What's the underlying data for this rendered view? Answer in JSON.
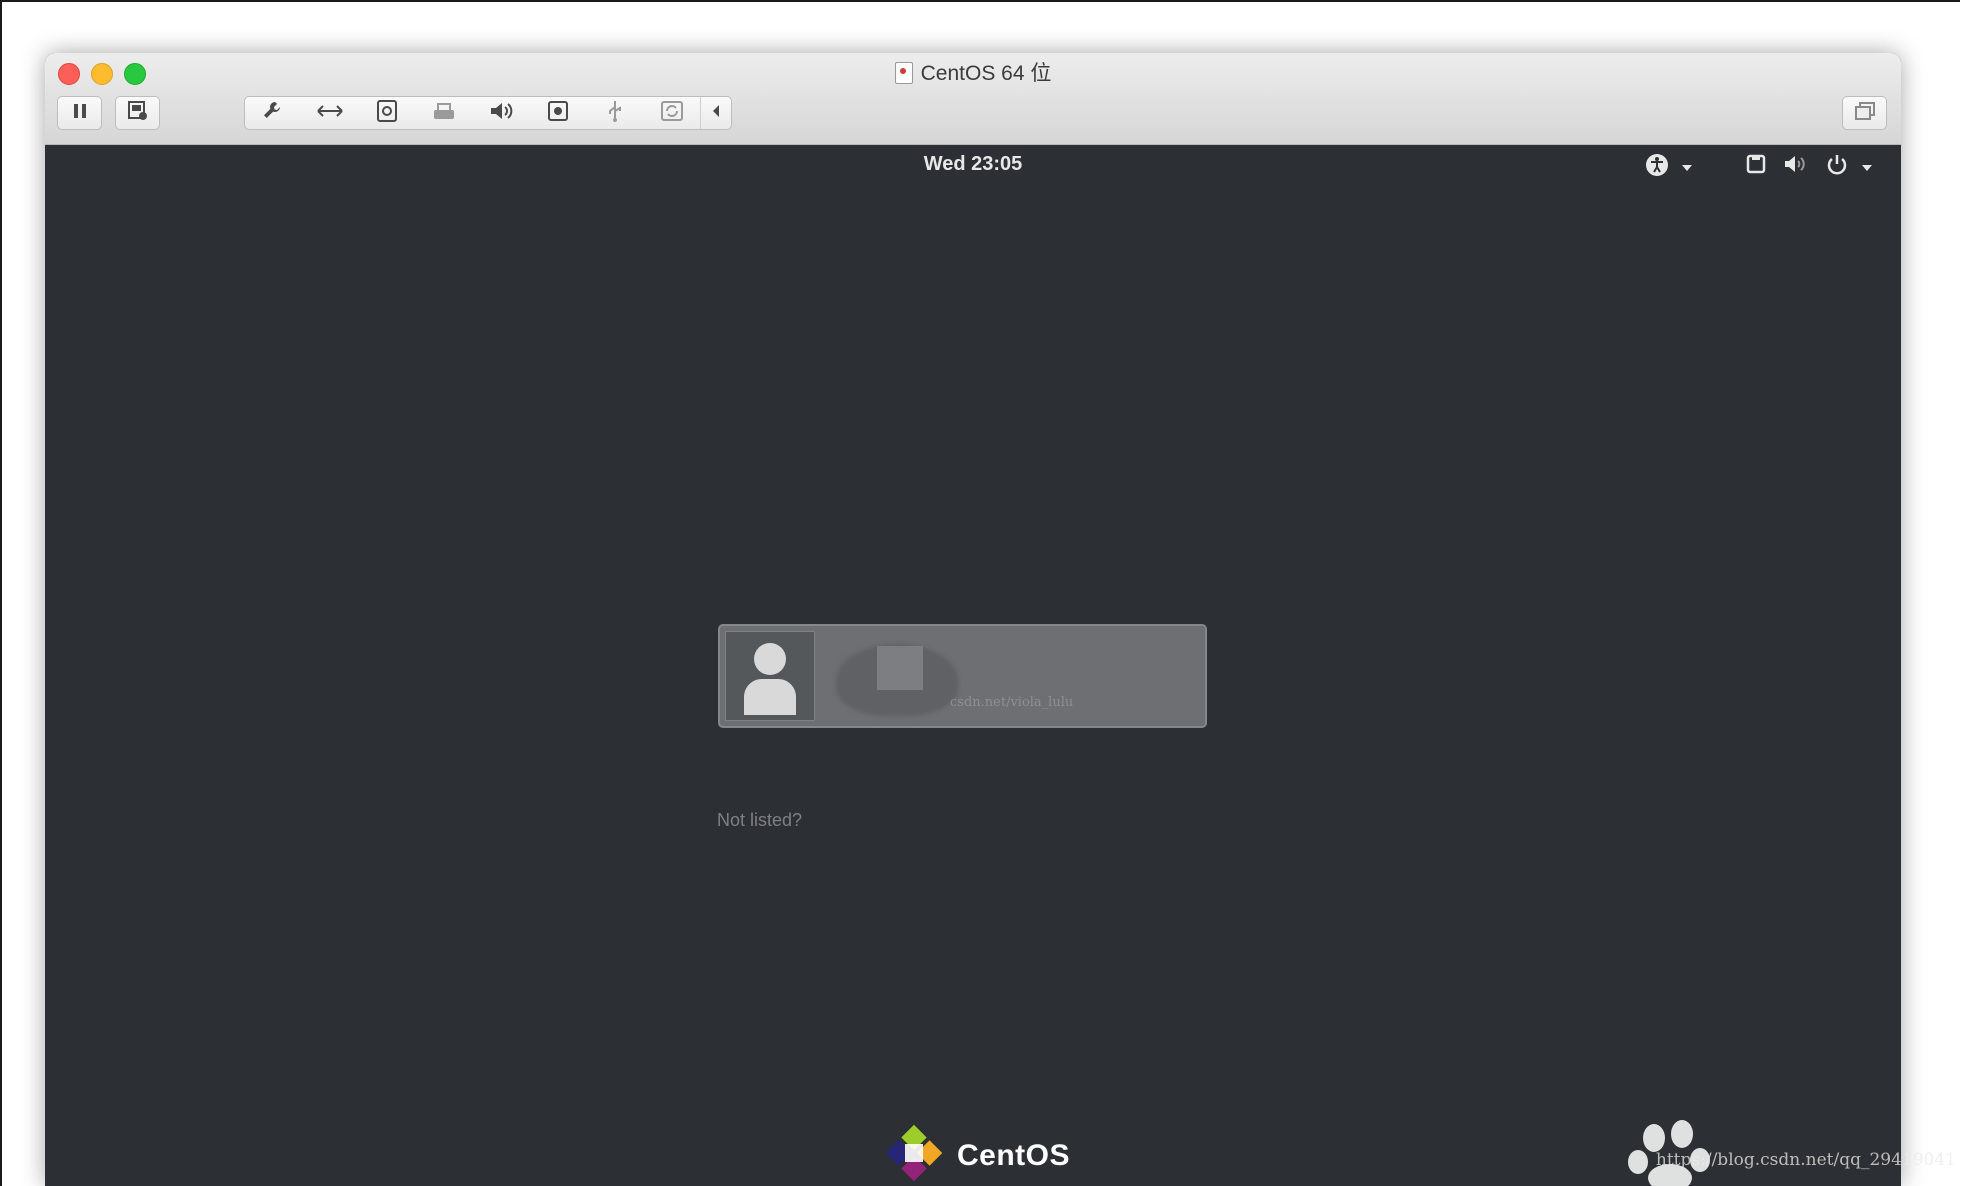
{
  "window": {
    "title": "CentOS 64 位"
  },
  "toolbar": {
    "left_buttons": [
      "pause-icon",
      "snapshot-icon"
    ],
    "group_icons": [
      "wrench-icon",
      "resize-arrows-icon",
      "disk-icon",
      "printer-icon",
      "speaker-icon",
      "camera-icon",
      "usb-icon",
      "refresh-icon"
    ],
    "right_button": "fullscreen-icon"
  },
  "topbar": {
    "clock": "Wed 23:05",
    "status_icons": [
      "accessibility-icon",
      "network-icon",
      "volume-icon",
      "power-icon"
    ]
  },
  "login": {
    "watermark_text": "csdn.net/viola_lulu",
    "not_listed": "Not listed?"
  },
  "brand": {
    "name": "CentOS"
  },
  "overlay": {
    "watermark_url": "https://blog.csdn.net/qq_29419041"
  }
}
